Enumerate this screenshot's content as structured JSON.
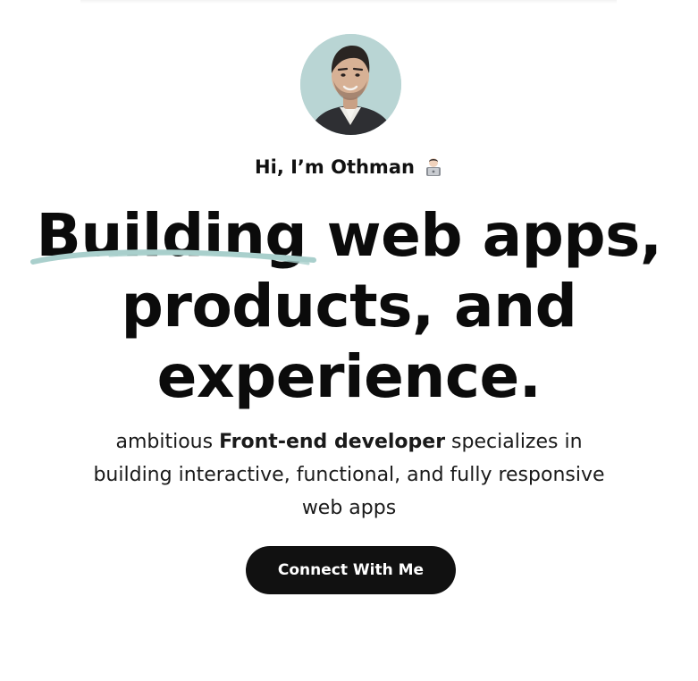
{
  "hero": {
    "greeting": "Hi, I’m Othman",
    "greeting_emoji": "technologist-emoji",
    "headline": {
      "emphasized_word": "Building",
      "line1_rest": " web apps,",
      "line2": "products, and",
      "line3": "experience."
    },
    "bio": {
      "before": "ambitious ",
      "strong": "Front-end developer",
      "after": " specializes in building interactive, functional, and fully responsive web apps"
    },
    "cta_label": "Connect With Me"
  },
  "colors": {
    "accent_stroke": "#a9cfcc",
    "avatar_bg": "#b9d5d4",
    "button_bg": "#111111",
    "text": "#111111"
  }
}
